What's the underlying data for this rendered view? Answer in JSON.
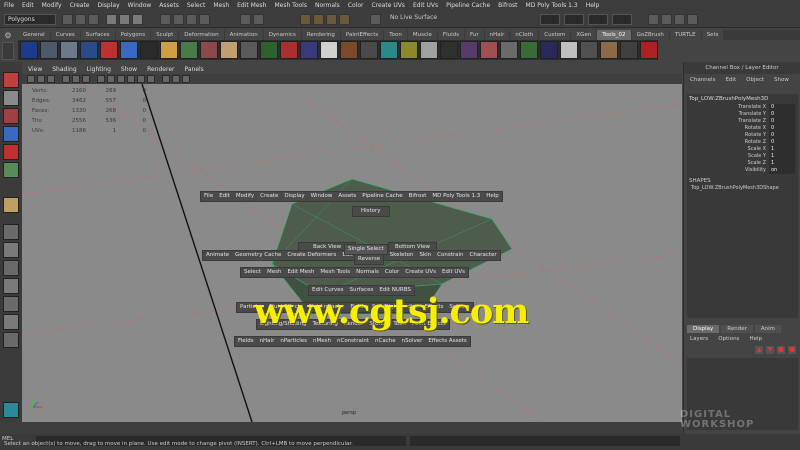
{
  "menubar": [
    "File",
    "Edit",
    "Modify",
    "Create",
    "Display",
    "Window",
    "Assets",
    "Select",
    "Mesh",
    "Edit Mesh",
    "Mesh Tools",
    "Normals",
    "Color",
    "Create UVs",
    "Edit UVs",
    "Pipeline Cache",
    "Bifrost",
    "MD Poly Tools 1.3",
    "Help"
  ],
  "status": {
    "mode": "Polygons",
    "live_surface": "No Live Surface"
  },
  "shelf_tabs": [
    {
      "label": "General",
      "active": false
    },
    {
      "label": "Curves",
      "active": false
    },
    {
      "label": "Surfaces",
      "active": false
    },
    {
      "label": "Polygons",
      "active": false
    },
    {
      "label": "Sculpt",
      "active": false
    },
    {
      "label": "Deformation",
      "active": false
    },
    {
      "label": "Animation",
      "active": false
    },
    {
      "label": "Dynamics",
      "active": false
    },
    {
      "label": "Rendering",
      "active": false
    },
    {
      "label": "PaintEffects",
      "active": false
    },
    {
      "label": "Toon",
      "active": false
    },
    {
      "label": "Muscle",
      "active": false
    },
    {
      "label": "Fluids",
      "active": false
    },
    {
      "label": "Fur",
      "active": false
    },
    {
      "label": "nHair",
      "active": false
    },
    {
      "label": "nCloth",
      "active": false
    },
    {
      "label": "Custom",
      "active": false
    },
    {
      "label": "XGen",
      "active": false
    },
    {
      "label": "Tools_02",
      "active": true
    },
    {
      "label": "GoZBrush",
      "active": false
    },
    {
      "label": "TURTLE",
      "active": false
    },
    {
      "label": "Sets",
      "active": false
    }
  ],
  "shelf_icon_colors": [
    "#1e3a8a",
    "#4a5a6a",
    "#6a7a8a",
    "#2a4a8a",
    "#c03030",
    "#3a6ac0",
    "#2a2a2a",
    "#d0a040",
    "#4a7a4a",
    "#8a4a4a",
    "#c0a070",
    "#5a5a5a",
    "#306030",
    "#aa3030",
    "#3a3a7a",
    "#d0d0d0",
    "#7a4a2a",
    "#4a4a4a",
    "#2a8a8a",
    "#8a8a2a",
    "#a0a0a0",
    "#303030",
    "#5a3a6a",
    "#a05050",
    "#6a6a6a",
    "#3a6a3a",
    "#2a2a5a",
    "#c0c0c0",
    "#505050",
    "#8a6a4a",
    "#404040",
    "#aa2222",
    "#3a5a8a",
    "#606060",
    "#7a7a7a",
    "#4a4a6a"
  ],
  "panel_menu": [
    "View",
    "Shading",
    "Lighting",
    "Show",
    "Renderer",
    "Panels"
  ],
  "hud": [
    {
      "label": "Verts:",
      "a": "2160",
      "b": "289",
      "c": "0"
    },
    {
      "label": "Edges:",
      "a": "3462",
      "b": "557",
      "c": "0"
    },
    {
      "label": "Faces:",
      "a": "1330",
      "b": "268",
      "c": "0"
    },
    {
      "label": "Tris:",
      "a": "2556",
      "b": "536",
      "c": "0"
    },
    {
      "label": "UVs:",
      "a": "1186",
      "b": "1",
      "c": "0"
    }
  ],
  "camera_label": "persp",
  "watermark": "www.cgtsj.com",
  "hotbox": {
    "row1": [
      "File",
      "Edit",
      "Modify",
      "Create",
      "Display",
      "Window",
      "Assets",
      "Pipeline Cache",
      "Bifrost",
      "MD Poly Tools 1.3",
      "Help"
    ],
    "history": "History",
    "back_view": "Back View",
    "bottom_view": "Bottom View",
    "reverse": "Reverse",
    "single_select": "Single Select",
    "row_anim": [
      "Animate",
      "Geometry Cache",
      "Create Deformers",
      "Edit Deformers",
      "Skeleton",
      "Skin",
      "Constrain",
      "Character"
    ],
    "row_model": [
      "Select",
      "Mesh",
      "Edit Mesh",
      "Mesh Tools",
      "Normals",
      "Color",
      "Create UVs",
      "Edit UVs"
    ],
    "row_curves": [
      "Edit Curves",
      "Surfaces",
      "Edit NURBS"
    ],
    "row_fx": [
      "Particles",
      "Fluid Effects",
      "Fluid nCache",
      "Fields",
      "Soft/Rigid Bodies",
      "Effects",
      "Solvers"
    ],
    "row_render": [
      "Lighting/Shading",
      "Texturing",
      "Render",
      "Stereo",
      "Toon",
      "Paint Effects"
    ],
    "row_nDyn": [
      "Fields",
      "nHair",
      "nParticles",
      "nMesh",
      "nConstraint",
      "nCache",
      "nSolver",
      "Effects Assets"
    ]
  },
  "channel_box": {
    "header": "Channel Box / Layer Editor",
    "tabs": [
      "Channels",
      "Edit",
      "Object",
      "Show"
    ],
    "object": "Top_LOW:ZBrushPolyMesh3D",
    "attributes": [
      {
        "name": "Translate X",
        "value": "0"
      },
      {
        "name": "Translate Y",
        "value": "0"
      },
      {
        "name": "Translate Z",
        "value": "0"
      },
      {
        "name": "Rotate X",
        "value": "0"
      },
      {
        "name": "Rotate Y",
        "value": "0"
      },
      {
        "name": "Rotate Z",
        "value": "0"
      },
      {
        "name": "Scale X",
        "value": "1"
      },
      {
        "name": "Scale Y",
        "value": "1"
      },
      {
        "name": "Scale Z",
        "value": "1"
      },
      {
        "name": "Visibility",
        "value": "on"
      }
    ],
    "shapes_label": "SHAPES",
    "shape_name": "Top_LOW:ZBrushPolyMesh3DShape"
  },
  "layer_editor": {
    "tabs": [
      {
        "label": "Display",
        "active": true
      },
      {
        "label": "Render",
        "active": false
      },
      {
        "label": "Anim",
        "active": false
      }
    ],
    "menu": [
      "Layers",
      "Options",
      "Help"
    ]
  },
  "command": {
    "mel_label": "MEL",
    "help_text": "Select an object(s) to move, drag to move in plane. Use edit mode to change pivot (INSERT). Ctrl+LMB to move perpendicular."
  },
  "logo": {
    "line1": "DIGITAL",
    "line2": "WORKSHOP"
  }
}
